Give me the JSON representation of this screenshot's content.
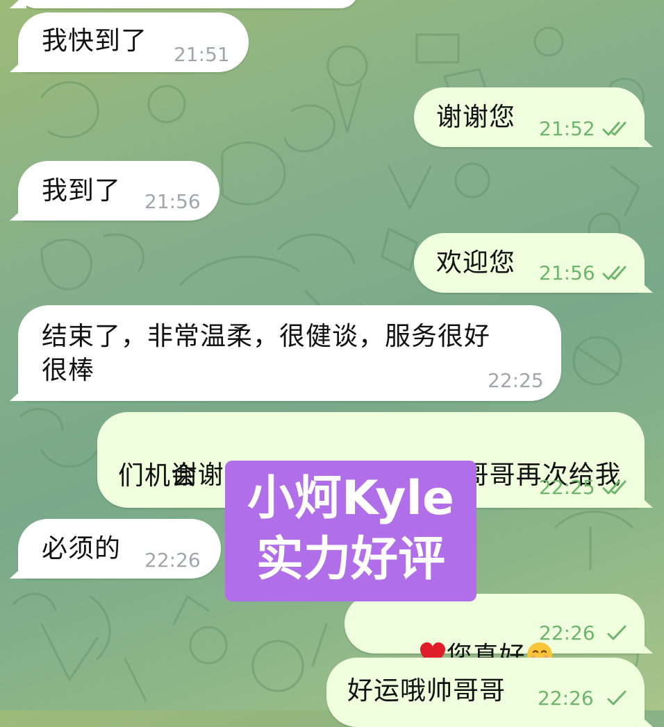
{
  "messages": [
    {
      "id": "m1",
      "direction": "in",
      "text": "我快到了",
      "time": "21:51"
    },
    {
      "id": "m2",
      "direction": "out",
      "text": "谢谢您",
      "time": "21:52",
      "status": "read"
    },
    {
      "id": "m3",
      "direction": "in",
      "text": "我到了",
      "time": "21:56"
    },
    {
      "id": "m4",
      "direction": "out",
      "text": "欢迎您",
      "time": "21:56",
      "status": "read"
    },
    {
      "id": "m5",
      "direction": "in",
      "text_line1": "结束了，非常温柔，很健谈，服务很好",
      "text_line2": "很棒",
      "time": "22:25"
    },
    {
      "id": "m6",
      "direction": "out",
      "text_part1": "谢谢小哥哥好评",
      "emoji1": "heart-emoji",
      "text_part2": "感恩小哥哥再次给我",
      "text_line2": "们机会",
      "time": "22:25",
      "status": "read"
    },
    {
      "id": "m7",
      "direction": "in",
      "text": "必须的",
      "time": "22:26"
    },
    {
      "id": "m8",
      "direction": "out",
      "emoji1": "heart-emoji",
      "text": "您真好",
      "emoji2": "smiling-face-emoji",
      "time": "22:26",
      "status": "sent"
    },
    {
      "id": "m9",
      "direction": "out",
      "text": "好运哦帅哥哥",
      "time": "22:26",
      "status": "sent"
    }
  ],
  "watermark": {
    "line1": "小炣Kyle",
    "line2": "实力好评",
    "color": "#b06ee8"
  },
  "colors": {
    "incoming_bubble": "#ffffff",
    "outgoing_bubble": "#effedd",
    "outgoing_time": "#6db56b",
    "incoming_time": "#a0a6ab"
  }
}
